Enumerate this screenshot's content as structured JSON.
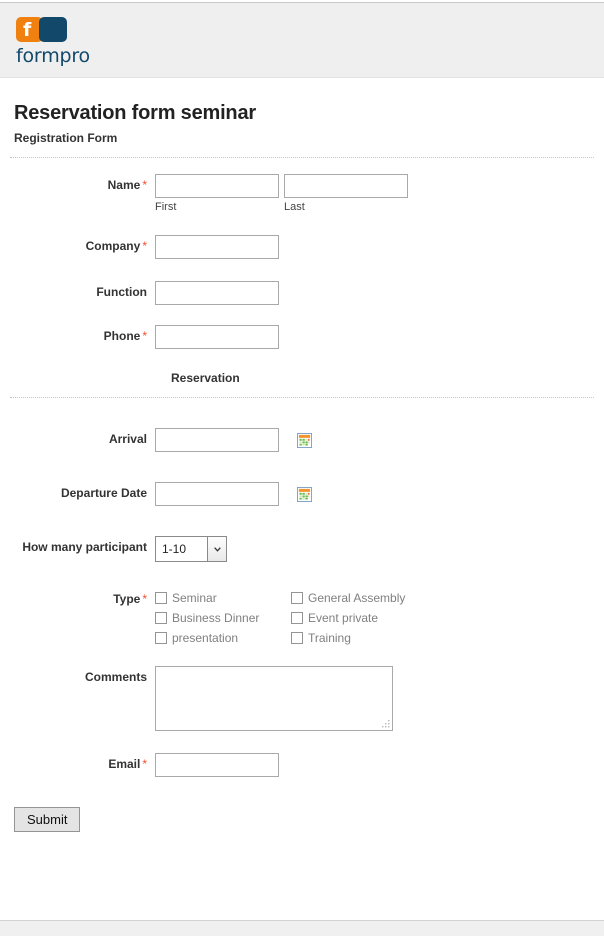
{
  "brand": {
    "name": "formpro",
    "mark_letter": "f",
    "orange": "#f08010",
    "navy": "#12496b"
  },
  "form": {
    "title": "Reservation form seminar",
    "subtitle": "Registration Form",
    "required_marker": "*"
  },
  "fields": {
    "name": {
      "label": "Name",
      "required": true,
      "first": {
        "value": "",
        "placeholder": "",
        "sublabel": "First"
      },
      "last": {
        "value": "",
        "placeholder": "",
        "sublabel": "Last"
      }
    },
    "company": {
      "label": "Company",
      "required": true,
      "value": "",
      "placeholder": ""
    },
    "function": {
      "label": "Function",
      "required": false,
      "value": "",
      "placeholder": ""
    },
    "phone": {
      "label": "Phone",
      "required": true,
      "value": "",
      "placeholder": ""
    },
    "arrival": {
      "label": "Arrival",
      "required": false,
      "value": "",
      "placeholder": "",
      "icon": "calendar-icon"
    },
    "departure": {
      "label": "Departure Date",
      "required": false,
      "value": "",
      "placeholder": "",
      "icon": "calendar-icon"
    },
    "participants": {
      "label": "How many participant",
      "required": false,
      "selected": "1-10",
      "options": [
        "1-10"
      ]
    },
    "type": {
      "label": "Type",
      "required": true,
      "columns": [
        [
          {
            "label": "Seminar",
            "checked": false
          },
          {
            "label": "Business Dinner",
            "checked": false
          },
          {
            "label": "presentation",
            "checked": false
          }
        ],
        [
          {
            "label": "General Assembly",
            "checked": false
          },
          {
            "label": "Event private",
            "checked": false
          },
          {
            "label": "Training",
            "checked": false
          }
        ]
      ]
    },
    "comments": {
      "label": "Comments",
      "required": false,
      "value": "",
      "placeholder": ""
    },
    "email": {
      "label": "Email",
      "required": true,
      "value": "",
      "placeholder": ""
    }
  },
  "sections": {
    "reservation_heading": "Reservation"
  },
  "actions": {
    "submit_label": "Submit"
  }
}
